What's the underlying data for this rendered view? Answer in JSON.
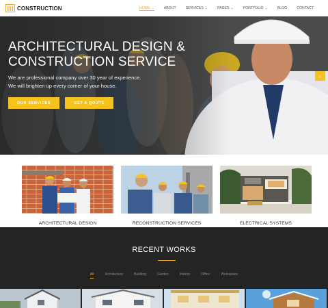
{
  "brand": {
    "name": "CONSTRUCTION",
    "accent": "#f5a623",
    "button_color": "#f7c21b"
  },
  "nav": {
    "items": [
      {
        "label": "HOME",
        "has_caret": true,
        "active": true
      },
      {
        "label": "ABOUT",
        "has_caret": false,
        "active": false
      },
      {
        "label": "SERVICES",
        "has_caret": true,
        "active": false
      },
      {
        "label": "PAGES",
        "has_caret": true,
        "active": false
      },
      {
        "label": "PORTFOLIO",
        "has_caret": true,
        "active": false
      },
      {
        "label": "BLOG",
        "has_caret": false,
        "active": false
      },
      {
        "label": "CONTACT",
        "has_caret": false,
        "active": false
      }
    ],
    "caret": "⌄"
  },
  "hero": {
    "title_line1": "ARCHITECTURAL DESIGN &",
    "title_line2": "CONSTRUCTION SERVICE",
    "sub_line1": "We are professional company over 30 year of experience.",
    "sub_line2": "We will brighten up every corner of your house.",
    "btn_services": "OUR SERVICES",
    "btn_quote": "GET A QOUTE",
    "next_arrow": "›"
  },
  "services": {
    "items": [
      {
        "label": "ARCHITECTURAL DESIGN"
      },
      {
        "label": "RECONSTRUCTION SERVICES"
      },
      {
        "label": "ELECTRICAL SYSTEMS"
      }
    ]
  },
  "works": {
    "title": "RECENT WORKS",
    "filters": [
      {
        "label": "All",
        "active": true
      },
      {
        "label": "Architecture",
        "active": false
      },
      {
        "label": "Building",
        "active": false
      },
      {
        "label": "Garden",
        "active": false
      },
      {
        "label": "Interior",
        "active": false
      },
      {
        "label": "Office",
        "active": false
      },
      {
        "label": "Workspace",
        "active": false
      }
    ]
  }
}
